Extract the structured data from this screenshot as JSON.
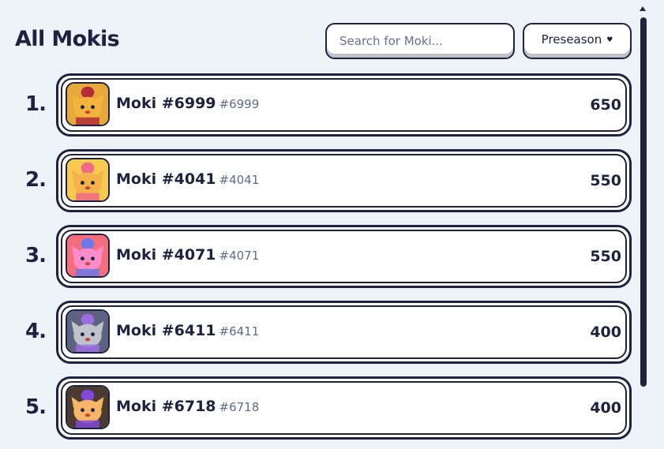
{
  "header": {
    "title": "All Mokis",
    "search_placeholder": "Search for Moki...",
    "season_label": "Preseason",
    "season_caret": "♥"
  },
  "leaderboard": [
    {
      "rank": "1.",
      "name": "Moki #6999",
      "tag": "#6999",
      "score": "650",
      "bg": "#e7a93a",
      "body": "#f3b33c",
      "accent": "#b42b3a"
    },
    {
      "rank": "2.",
      "name": "Moki #4041",
      "tag": "#4041",
      "score": "550",
      "bg": "#f7c94e",
      "body": "#f6b34b",
      "accent": "#ef6a86"
    },
    {
      "rank": "3.",
      "name": "Moki #4071",
      "tag": "#4071",
      "score": "550",
      "bg": "#f56e7c",
      "body": "#ff8cc8",
      "accent": "#6a78e8"
    },
    {
      "rank": "4.",
      "name": "Moki #6411",
      "tag": "#6411",
      "score": "400",
      "bg": "#5e6280",
      "body": "#bfc3cc",
      "accent": "#9b6ee0"
    },
    {
      "rank": "5.",
      "name": "Moki #6718",
      "tag": "#6718",
      "score": "400",
      "bg": "#4a3a30",
      "body": "#f7b667",
      "accent": "#7f48d8"
    }
  ]
}
